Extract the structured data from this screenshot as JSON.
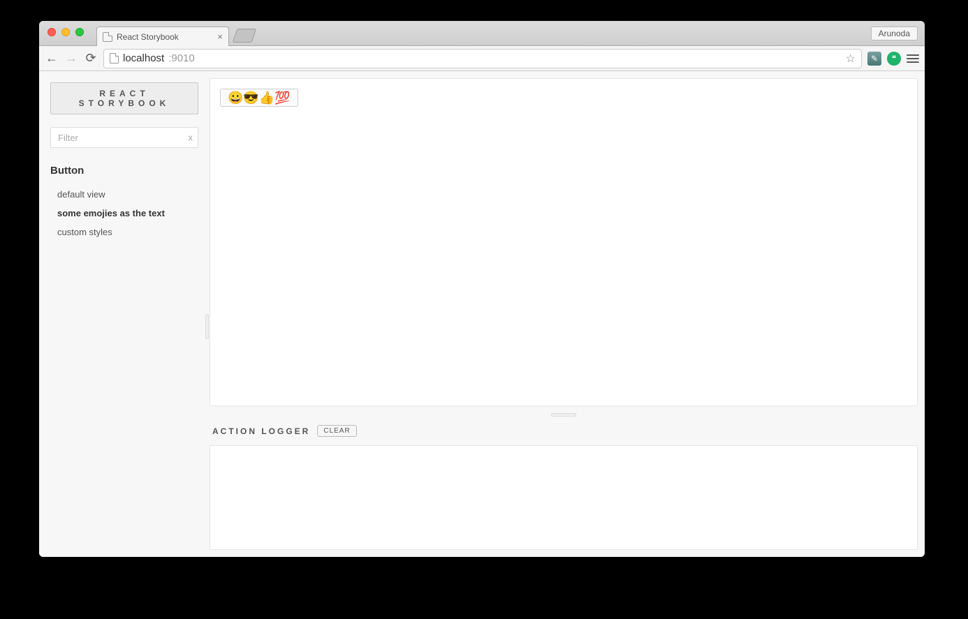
{
  "browser": {
    "tab_title": "React Storybook",
    "tab_close": "×",
    "profile_name": "Arunoda",
    "url_host": "localhost",
    "url_port": ":9010"
  },
  "sidebar": {
    "brand": "REACT STORYBOOK",
    "filter_placeholder": "Filter",
    "filter_clear": "x",
    "group": "Button",
    "stories": [
      {
        "label": "default view",
        "active": false
      },
      {
        "label": "some emojies as the text",
        "active": true
      },
      {
        "label": "custom styles",
        "active": false
      }
    ]
  },
  "preview": {
    "button_text": "😀😎👍💯"
  },
  "logger": {
    "title": "ACTION LOGGER",
    "clear": "CLEAR"
  }
}
